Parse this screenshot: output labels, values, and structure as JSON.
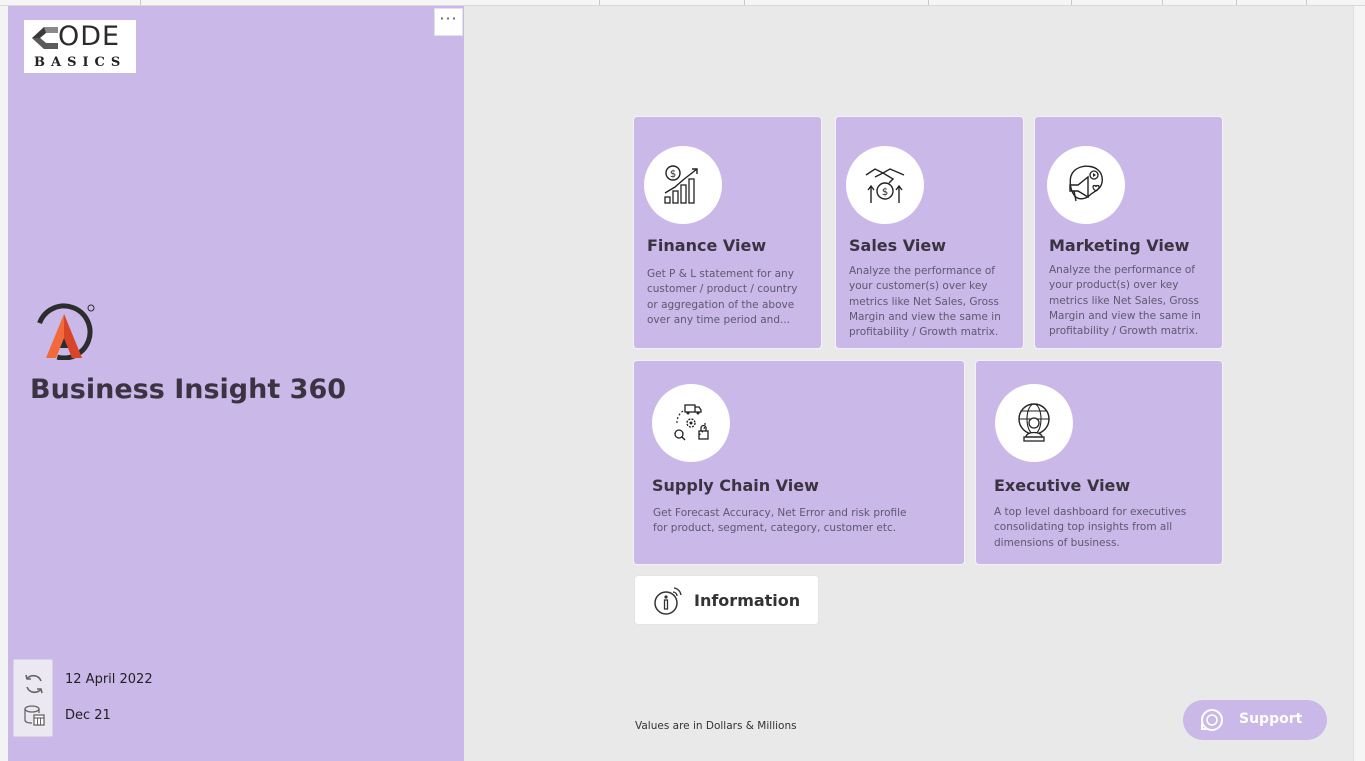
{
  "brand": {
    "code_basics_logo": "CODE BASICS",
    "app_title": "Business Insight 360"
  },
  "refresh": {
    "last_refreshed": "12 April 2022",
    "data_until": "Dec 21"
  },
  "menu": {
    "more_options": "···"
  },
  "cards": [
    {
      "title": "Finance View",
      "desc": "Get P & L statement for any customer / product / country or aggregation of the above over any time period and...",
      "icon": "finance-growth-icon"
    },
    {
      "title": "Sales View",
      "desc": "Analyze the performance of your customer(s) over key metrics like Net Sales, Gross Margin and view the same in profitability / Growth matrix.",
      "icon": "handshake-money-icon"
    },
    {
      "title": "Marketing View",
      "desc": "Analyze the performance of your product(s) over key metrics like Net Sales, Gross Margin and view the same in profitability / Growth matrix.",
      "icon": "megaphone-icon"
    },
    {
      "title": "Supply Chain View",
      "desc": "Get Forecast Accuracy, Net Error and risk profile for product, segment, category, customer etc.",
      "icon": "supply-chain-icon"
    },
    {
      "title": "Executive View",
      "desc": "A top level dashboard for executives consolidating top insights from all dimensions of business.",
      "icon": "globe-executive-icon"
    }
  ],
  "info_button": {
    "label": "Information",
    "icon": "info-icon"
  },
  "footnote": "Values are in Dollars & Millions",
  "support_button": {
    "label": "Support",
    "icon": "headset-icon"
  },
  "colors": {
    "accent_purple": "#c9b8e8",
    "canvas": "#e9e9e9",
    "title_text": "#3b3341",
    "logo_orange": "#f26a3a"
  }
}
